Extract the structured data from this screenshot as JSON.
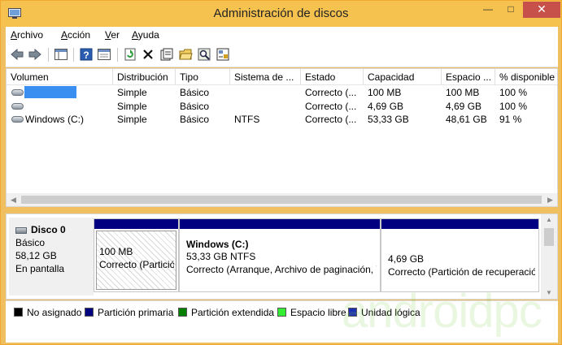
{
  "window": {
    "title": "Administración de discos",
    "min_glyph": "—",
    "max_glyph": "□",
    "close_glyph": "✕"
  },
  "menu": [
    {
      "pre": "",
      "u": "A",
      "post": "rchivo"
    },
    {
      "pre": "",
      "u": "A",
      "post": "cción"
    },
    {
      "pre": "",
      "u": "V",
      "post": "er"
    },
    {
      "pre": "",
      "u": "A",
      "post": "yuda"
    }
  ],
  "toolbar": {
    "back_icon": "arrow-left-icon",
    "forward_icon": "arrow-right-icon",
    "icons": [
      "console-tree-icon",
      "help-icon",
      "properties-list-icon",
      "refresh-icon",
      "delete-icon",
      "properties-icon",
      "open-folder-icon",
      "search-icon",
      "settings-icon"
    ]
  },
  "volumes": {
    "columns": [
      "Volumen",
      "Distribución",
      "Tipo",
      "Sistema de ...",
      "Estado",
      "Capacidad",
      "Espacio ...",
      "% disponible"
    ],
    "rows": [
      {
        "volume": "",
        "layout": "Simple",
        "type": "Básico",
        "fs": "",
        "status": "Correcto (...",
        "capacity": "100 MB",
        "free": "100 MB",
        "pct": "100 %"
      },
      {
        "volume": "",
        "layout": "Simple",
        "type": "Básico",
        "fs": "",
        "status": "Correcto (...",
        "capacity": "4,69 GB",
        "free": "4,69 GB",
        "pct": "100 %"
      },
      {
        "volume": "Windows (C:)",
        "layout": "Simple",
        "type": "Básico",
        "fs": "NTFS",
        "status": "Correcto (...",
        "capacity": "53,33 GB",
        "free": "48,61 GB",
        "pct": "91 %"
      }
    ]
  },
  "disk": {
    "name": "Disco 0",
    "type": "Básico",
    "size": "58,12 GB",
    "state": "En pantalla",
    "partitions": [
      {
        "title": "",
        "size": "100 MB",
        "status": "Correcto (Partición del sistema...",
        "selected": true
      },
      {
        "title": "Windows  (C:)",
        "size": "53,33 GB NTFS",
        "status": "Correcto (Arranque, Archivo de paginación, Volcado...",
        "selected": false
      },
      {
        "title": "",
        "size": "4,69 GB",
        "status": "Correcto (Partición de recuperación)",
        "selected": false
      }
    ]
  },
  "legend": [
    {
      "label": "No asignado",
      "color": "#000000"
    },
    {
      "label": "Partición primaria",
      "color": "#000080"
    },
    {
      "label": "Partición extendida",
      "color": "#008000"
    },
    {
      "label": "Espacio libre",
      "color": "#33ee33"
    },
    {
      "label": "Unidad lógica",
      "color": "#1d2fb3"
    }
  ],
  "watermark": "androidpc",
  "colors": {
    "titlebar": "#f5c24f",
    "close_button": "#c7504a",
    "partition_bar": "#000080",
    "selection": "#3b8ff0"
  }
}
